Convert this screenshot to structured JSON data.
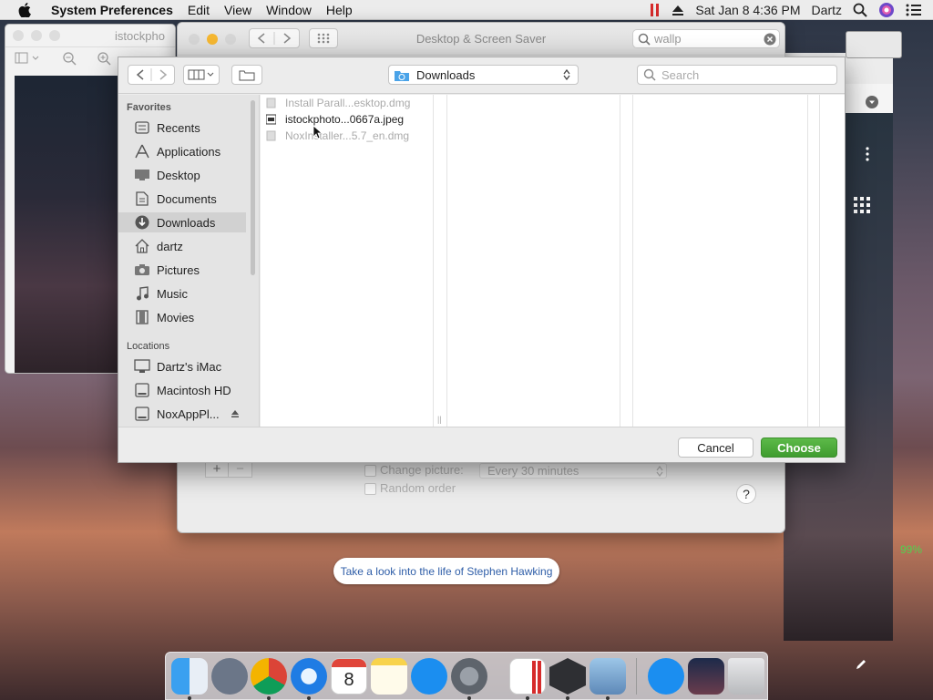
{
  "menubar": {
    "app_name": "System Preferences",
    "menus": [
      "Edit",
      "View",
      "Window",
      "Help"
    ],
    "clock": "Sat Jan 8  4:36 PM",
    "user": "Dartz"
  },
  "preview_window": {
    "title": "istockpho"
  },
  "prefs_window": {
    "title": "Desktop & Screen Saver",
    "search_value": "wallp",
    "change_picture_label": "Change picture:",
    "interval_value": "Every 30 minutes",
    "random_order_label": "Random order",
    "help_label": "?"
  },
  "dialog": {
    "location": "Downloads",
    "search_placeholder": "Search",
    "sidebar": {
      "favorites_header": "Favorites",
      "favorites": [
        {
          "label": "Recents",
          "icon": "recents-icon"
        },
        {
          "label": "Applications",
          "icon": "applications-icon"
        },
        {
          "label": "Desktop",
          "icon": "desktop-icon"
        },
        {
          "label": "Documents",
          "icon": "documents-icon"
        },
        {
          "label": "Downloads",
          "icon": "downloads-icon",
          "selected": true
        },
        {
          "label": "dartz",
          "icon": "home-icon"
        },
        {
          "label": "Pictures",
          "icon": "pictures-icon"
        },
        {
          "label": "Music",
          "icon": "music-icon"
        },
        {
          "label": "Movies",
          "icon": "movies-icon"
        }
      ],
      "locations_header": "Locations",
      "locations": [
        {
          "label": "Dartz's iMac",
          "icon": "computer-icon"
        },
        {
          "label": "Macintosh HD",
          "icon": "disk-icon"
        },
        {
          "label": "NoxAppPl...",
          "icon": "disk-icon"
        }
      ]
    },
    "files": [
      {
        "name": "Install Parall...esktop.dmg",
        "enabled": false
      },
      {
        "name": "istockphoto...0667a.jpeg",
        "enabled": true
      },
      {
        "name": "NoxInstaller...5.7_en.dmg",
        "enabled": false
      }
    ],
    "cancel_label": "Cancel",
    "choose_label": "Choose"
  },
  "right_panel": {
    "battery_text": "99%"
  },
  "tooltip": "Take a look into the life of Stephen Hawking",
  "dock": {
    "calendar_day": "8",
    "apps": [
      "Finder",
      "Launchpad",
      "Chrome",
      "Safari",
      "Calendar",
      "Notes",
      "App Store",
      "System Preferences",
      "Parallels",
      "Nox",
      "Preview",
      "App Store Downloads",
      "Photos",
      "Trash"
    ]
  },
  "colors": {
    "accent": "#3a8ee6",
    "choose_green": "#4caf3a",
    "link_blue": "#2f5ea8"
  }
}
